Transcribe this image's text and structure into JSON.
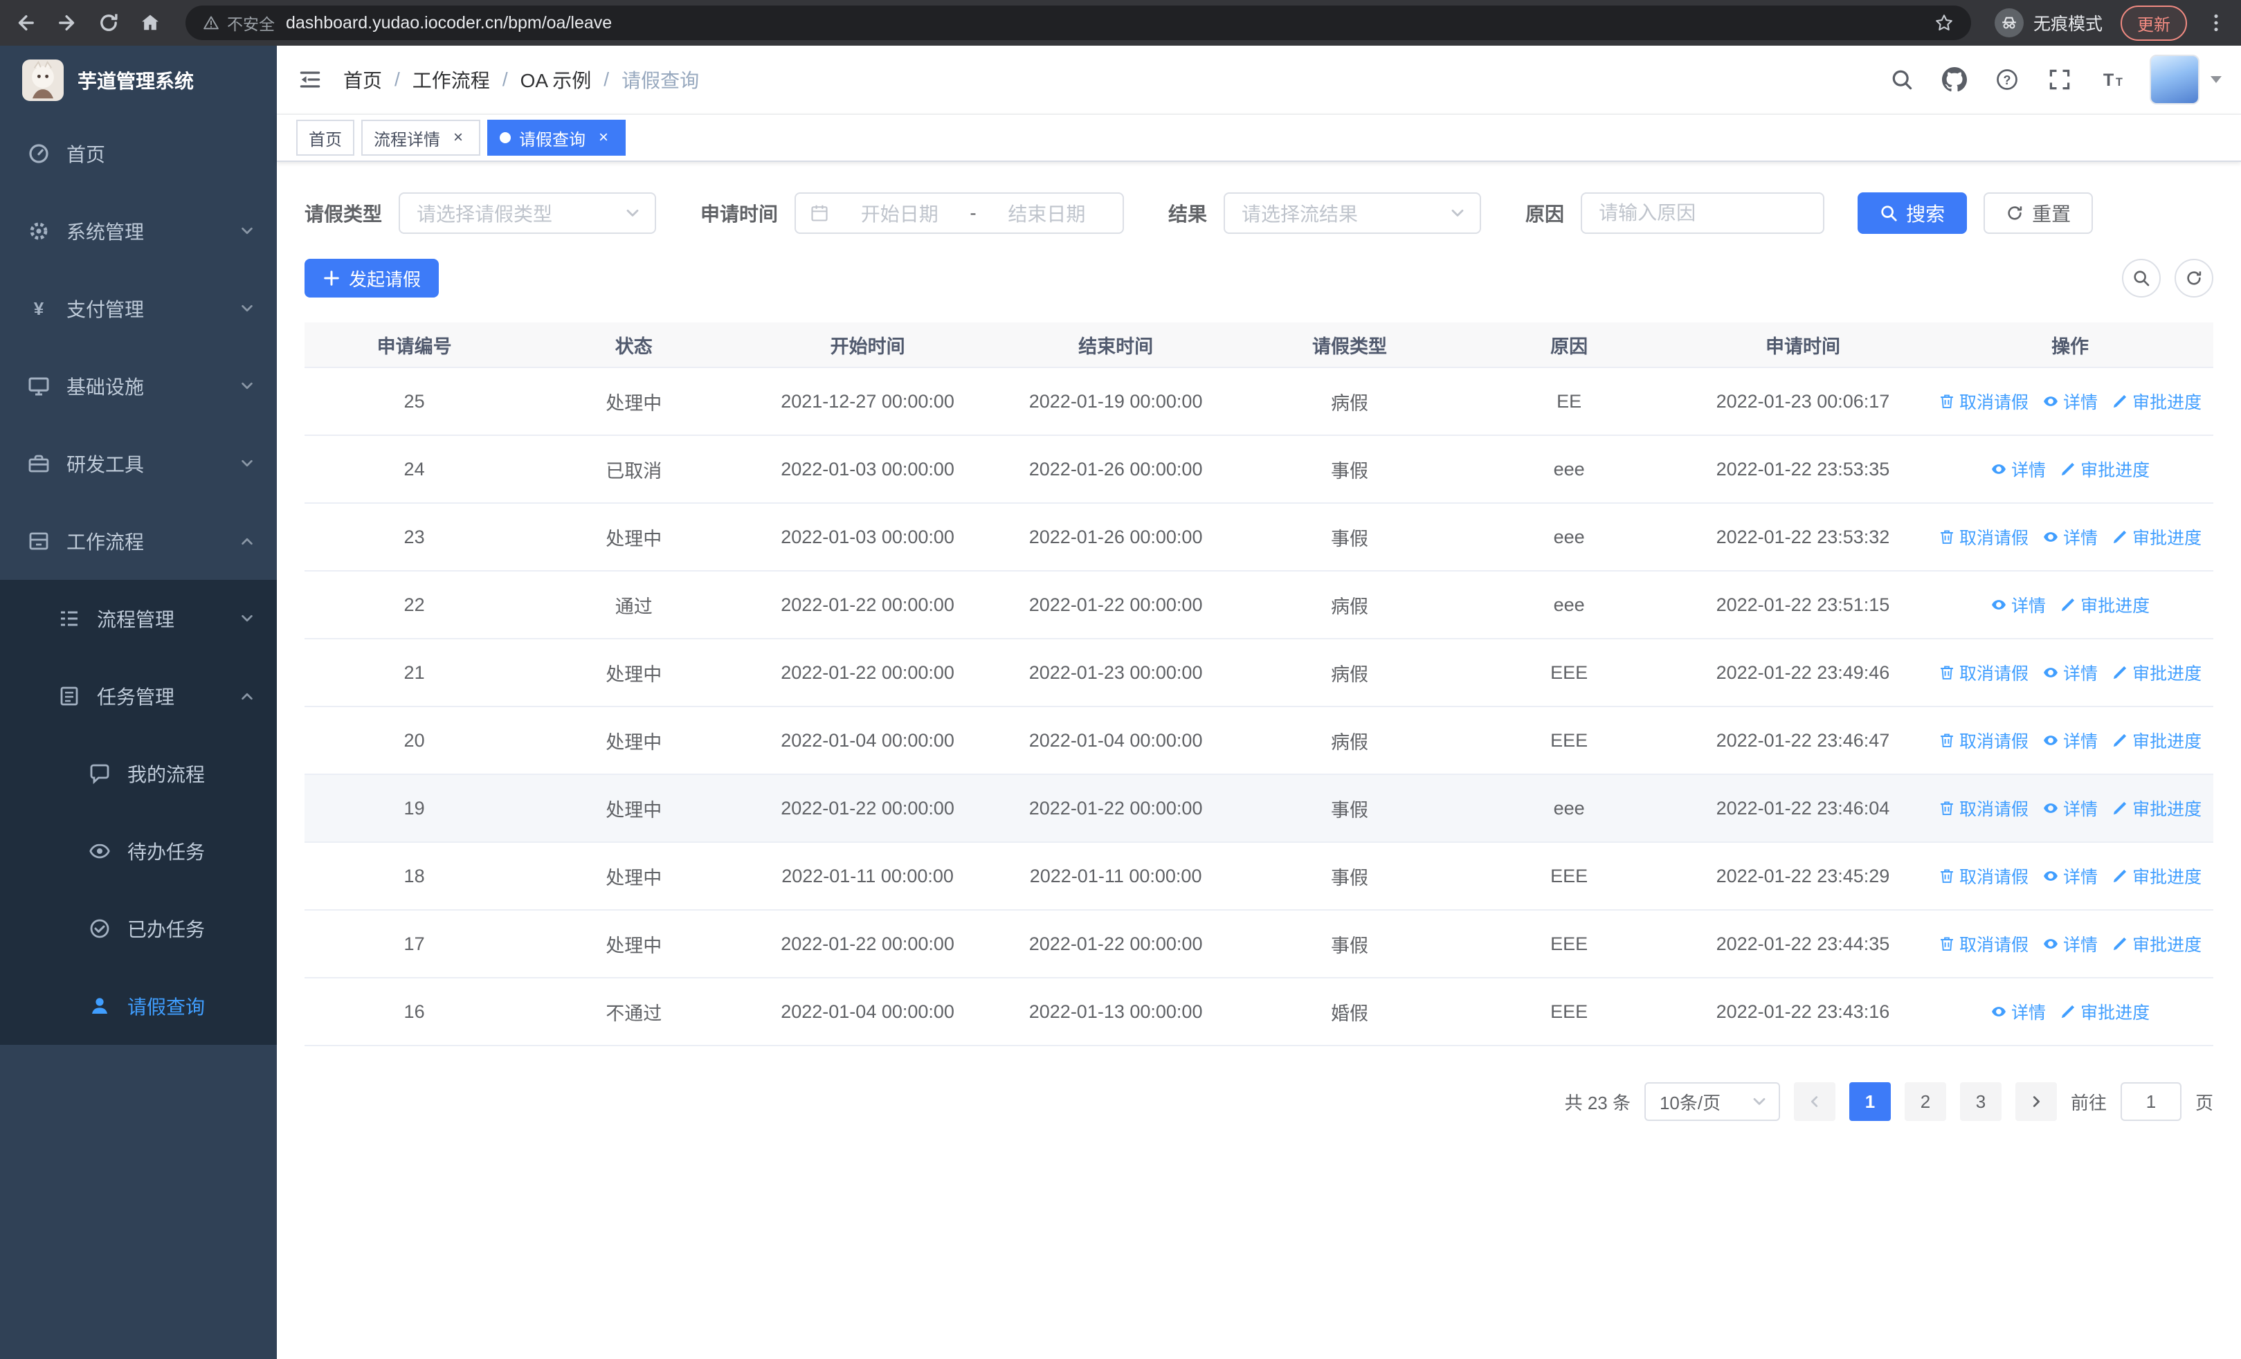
{
  "colors": {
    "accent": "#3d7bf8",
    "link": "#409eff",
    "sidebar_bg": "#304156",
    "sidebar_sub_bg": "#1f2d3d",
    "active_text": "#409eff"
  },
  "browser": {
    "security_text": "不安全",
    "url": "dashboard.yudao.iocoder.cn/bpm/oa/leave",
    "incognito_label": "无痕模式",
    "update_label": "更新"
  },
  "sidebar": {
    "title": "芋道管理系统",
    "items": [
      {
        "label": "首页"
      },
      {
        "label": "系统管理"
      },
      {
        "label": "支付管理"
      },
      {
        "label": "基础设施"
      },
      {
        "label": "研发工具"
      },
      {
        "label": "工作流程"
      }
    ],
    "workflow_children": [
      {
        "label": "流程管理"
      },
      {
        "label": "任务管理"
      }
    ],
    "task_children": [
      {
        "label": "我的流程"
      },
      {
        "label": "待办任务"
      },
      {
        "label": "已办任务"
      },
      {
        "label": "请假查询"
      }
    ]
  },
  "header": {
    "breadcrumb": [
      "首页",
      "工作流程",
      "OA 示例",
      "请假查询"
    ]
  },
  "tabs": [
    {
      "label": "首页"
    },
    {
      "label": "流程详情",
      "closable": true
    },
    {
      "label": "请假查询",
      "closable": true,
      "active": true
    }
  ],
  "filters": {
    "leave_type_label": "请假类型",
    "leave_type_placeholder": "请选择请假类型",
    "apply_time_label": "申请时间",
    "start_date_placeholder": "开始日期",
    "range_separator": "-",
    "end_date_placeholder": "结束日期",
    "result_label": "结果",
    "result_placeholder": "请选择流结果",
    "reason_label": "原因",
    "reason_placeholder": "请输入原因",
    "search_label": "搜索",
    "reset_label": "重置"
  },
  "toolbar": {
    "create_label": "发起请假"
  },
  "table": {
    "columns": [
      "申请编号",
      "状态",
      "开始时间",
      "结束时间",
      "请假类型",
      "原因",
      "申请时间",
      "操作"
    ],
    "action_labels": {
      "cancel": "取消请假",
      "detail": "详情",
      "progress": "审批进度"
    },
    "rows": [
      {
        "id": "25",
        "status": "处理中",
        "start": "2021-12-27 00:00:00",
        "end": "2022-01-19 00:00:00",
        "type": "病假",
        "reason": "EE",
        "apply_time": "2022-01-23 00:06:17",
        "actions": [
          "cancel",
          "detail",
          "progress"
        ]
      },
      {
        "id": "24",
        "status": "已取消",
        "start": "2022-01-03 00:00:00",
        "end": "2022-01-26 00:00:00",
        "type": "事假",
        "reason": "eee",
        "apply_time": "2022-01-22 23:53:35",
        "actions": [
          "detail",
          "progress"
        ]
      },
      {
        "id": "23",
        "status": "处理中",
        "start": "2022-01-03 00:00:00",
        "end": "2022-01-26 00:00:00",
        "type": "事假",
        "reason": "eee",
        "apply_time": "2022-01-22 23:53:32",
        "actions": [
          "cancel",
          "detail",
          "progress"
        ]
      },
      {
        "id": "22",
        "status": "通过",
        "start": "2022-01-22 00:00:00",
        "end": "2022-01-22 00:00:00",
        "type": "病假",
        "reason": "eee",
        "apply_time": "2022-01-22 23:51:15",
        "actions": [
          "detail",
          "progress"
        ]
      },
      {
        "id": "21",
        "status": "处理中",
        "start": "2022-01-22 00:00:00",
        "end": "2022-01-23 00:00:00",
        "type": "病假",
        "reason": "EEE",
        "apply_time": "2022-01-22 23:49:46",
        "actions": [
          "cancel",
          "detail",
          "progress"
        ]
      },
      {
        "id": "20",
        "status": "处理中",
        "start": "2022-01-04 00:00:00",
        "end": "2022-01-04 00:00:00",
        "type": "病假",
        "reason": "EEE",
        "apply_time": "2022-01-22 23:46:47",
        "actions": [
          "cancel",
          "detail",
          "progress"
        ]
      },
      {
        "id": "19",
        "status": "处理中",
        "start": "2022-01-22 00:00:00",
        "end": "2022-01-22 00:00:00",
        "type": "事假",
        "reason": "eee",
        "apply_time": "2022-01-22 23:46:04",
        "actions": [
          "cancel",
          "detail",
          "progress"
        ],
        "highlighted": true
      },
      {
        "id": "18",
        "status": "处理中",
        "start": "2022-01-11 00:00:00",
        "end": "2022-01-11 00:00:00",
        "type": "事假",
        "reason": "EEE",
        "apply_time": "2022-01-22 23:45:29",
        "actions": [
          "cancel",
          "detail",
          "progress"
        ]
      },
      {
        "id": "17",
        "status": "处理中",
        "start": "2022-01-22 00:00:00",
        "end": "2022-01-22 00:00:00",
        "type": "事假",
        "reason": "EEE",
        "apply_time": "2022-01-22 23:44:35",
        "actions": [
          "cancel",
          "detail",
          "progress"
        ]
      },
      {
        "id": "16",
        "status": "不通过",
        "start": "2022-01-04 00:00:00",
        "end": "2022-01-13 00:00:00",
        "type": "婚假",
        "reason": "EEE",
        "apply_time": "2022-01-22 23:43:16",
        "actions": [
          "detail",
          "progress"
        ]
      }
    ]
  },
  "pagination": {
    "total_text": "共 23 条",
    "page_size": "10条/页",
    "pages": [
      "1",
      "2",
      "3"
    ],
    "active_page": "1",
    "goto_label": "前往",
    "goto_value": "1",
    "page_label": "页"
  }
}
